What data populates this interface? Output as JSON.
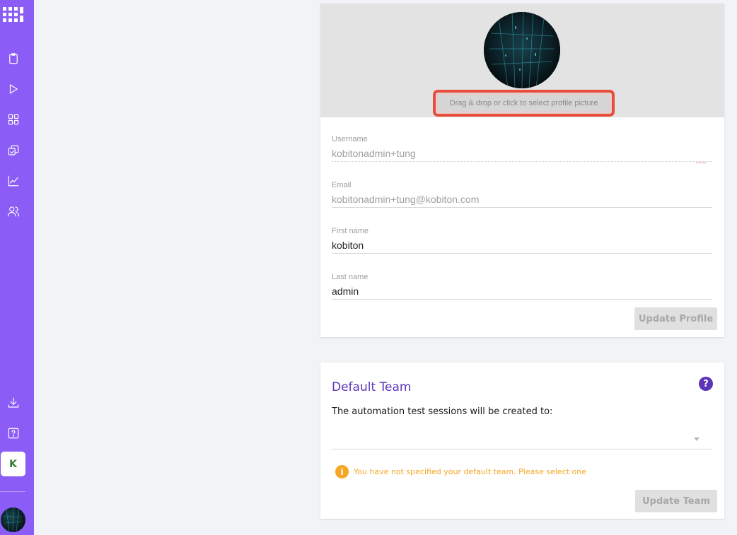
{
  "sidebar": {
    "logo": "kobiton-logo",
    "items": [
      {
        "name": "sidebar-item-clipboard",
        "icon": "clipboard-icon"
      },
      {
        "name": "sidebar-item-play",
        "icon": "play-icon"
      },
      {
        "name": "sidebar-item-grid",
        "icon": "grid-icon"
      },
      {
        "name": "sidebar-item-copy",
        "icon": "copy-icon"
      },
      {
        "name": "sidebar-item-analytics",
        "icon": "chart-icon"
      },
      {
        "name": "sidebar-item-users",
        "icon": "users-icon"
      },
      {
        "name": "sidebar-item-download",
        "icon": "download-icon"
      },
      {
        "name": "sidebar-item-help",
        "icon": "help-icon"
      }
    ],
    "org_badge": "K"
  },
  "profile": {
    "drop_text": "Drag & drop or click to select profile picture",
    "fields": [
      {
        "label": "Username",
        "value": "kobitonadmin+tung"
      },
      {
        "label": "Email",
        "value": "kobitonadmin+tung@kobiton.com"
      },
      {
        "label": "First name",
        "value": "kobiton"
      },
      {
        "label": "Last name",
        "value": "admin"
      }
    ],
    "update_button": "Update Profile"
  },
  "team": {
    "title": "Default Team",
    "help": "?",
    "description": "The automation test sessions will be created to:",
    "selected": "",
    "warning_icon": "i",
    "warning": "You have not specified your default team. Please select one",
    "update_button": "Update Team"
  },
  "colors": {
    "sidebar": "#8b5cf6",
    "accent": "#5b34b8",
    "warning": "#f5a623",
    "highlight": "#e74c3c"
  }
}
